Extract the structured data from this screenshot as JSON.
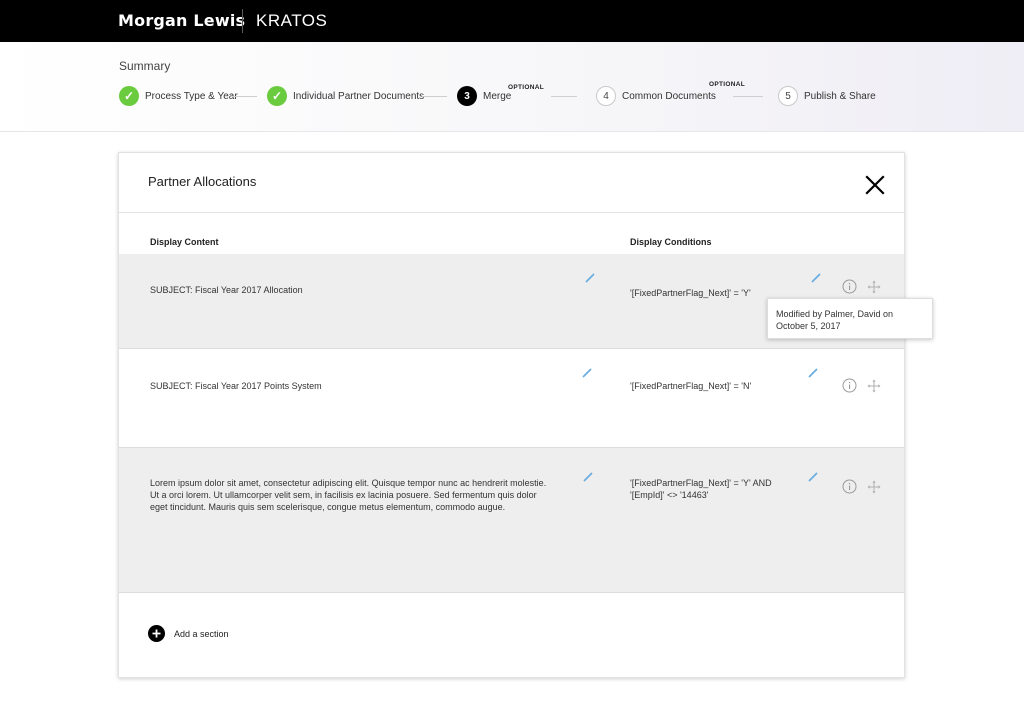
{
  "header": {
    "brand": "Morgan Lewis",
    "product": "KRATOS"
  },
  "summary": {
    "title": "Summary",
    "steps": [
      {
        "marker": "✓",
        "label": "Process Type & Year",
        "status": "done"
      },
      {
        "marker": "✓",
        "label": "Individual Partner Documents",
        "status": "done"
      },
      {
        "marker": "3",
        "label": "Merge",
        "status": "active",
        "badge": "OPTIONAL"
      },
      {
        "marker": "4",
        "label": "Common Documents",
        "status": "pending",
        "badge": "OPTIONAL"
      },
      {
        "marker": "5",
        "label": "Publish & Share",
        "status": "pending"
      }
    ]
  },
  "modal": {
    "title": "Partner Allocations",
    "close_icon": "close-icon",
    "columns": {
      "content": "Display Content",
      "conditions": "Display Conditions"
    },
    "rows": [
      {
        "content": "SUBJECT: Fiscal Year 2017 Allocation",
        "condition_lines": [
          "'[FixedPartnerFlag_Next]' = 'Y'"
        ],
        "shaded": true
      },
      {
        "content": "SUBJECT: Fiscal Year 2017 Points System",
        "condition_lines": [
          "'[FixedPartnerFlag_Next]' = 'N'"
        ],
        "shaded": false
      },
      {
        "content_lines": [
          "Lorem ipsum dolor sit amet, consectetur adipiscing elit. Quisque tempor nunc ac hendrerit molestie.",
          "Ut a orci lorem. Ut ullamcorper velit sem, in facilisis ex lacinia posuere. Sed fermentum quis dolor",
          "eget tincidunt. Mauris quis sem scelerisque, congue metus elementum, commodo augue."
        ],
        "condition_lines": [
          "'[FixedPartnerFlag_Next]' = 'Y' AND",
          "'[EmpId]' <> '14463'"
        ],
        "shaded": true
      }
    ],
    "add_section_label": "Add a section"
  },
  "tooltip": {
    "lines": [
      "Modified by Palmer, David on",
      "October 5, 2017"
    ]
  },
  "colors": {
    "success": "#6bcb3f",
    "topbar": "#000000",
    "row_shade": "#eeeeee",
    "edit_accent": "#6aaee0"
  },
  "icons": [
    "check-icon",
    "close-icon",
    "pencil-icon",
    "info-icon",
    "move-icon",
    "plus-icon"
  ]
}
